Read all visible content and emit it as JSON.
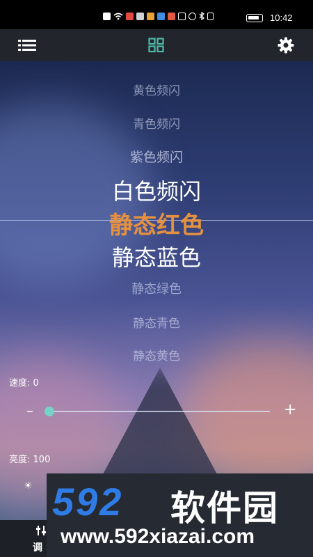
{
  "status_bar": {
    "time": "10:42",
    "icons": [
      "notification-icon",
      "wifi-icon",
      "app-icon",
      "app-icon",
      "app-icon",
      "app-icon",
      "app-icon",
      "nfc-icon",
      "alarm-icon",
      "bluetooth-icon",
      "vibrate-icon",
      "battery-icon"
    ]
  },
  "top_bar": {
    "left_icon": "list-icon",
    "center_icon": "grid-icon",
    "right_icon": "gear-icon",
    "accent_color": "#4fb9a8"
  },
  "picker": {
    "items": [
      "黄色频闪",
      "青色频闪",
      "紫色频闪",
      "白色频闪",
      "静态红色",
      "静态蓝色",
      "静态绿色",
      "静态青色",
      "静态黄色"
    ],
    "selected": "静态红色",
    "selected_color": "#e6913f"
  },
  "speed": {
    "label": "速度:",
    "value": "0",
    "minus": "–",
    "plus": "+",
    "thumb_color": "#73d3c6"
  },
  "brightness": {
    "label": "亮度:",
    "value": "100",
    "icon": "sun-icon"
  },
  "bottom_tab": {
    "label": "调"
  },
  "watermark": {
    "logo": "592",
    "name": "软件园",
    "url": "www.592xiazai.com"
  }
}
